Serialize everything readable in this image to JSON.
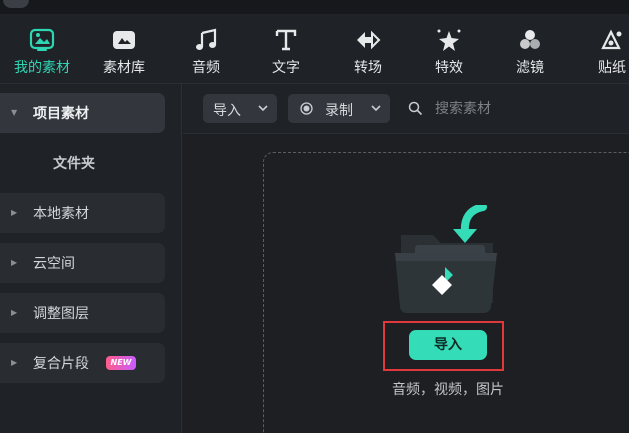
{
  "toolbar": {
    "items": [
      {
        "label": "我的素材",
        "icon": "my-media-icon",
        "active": true
      },
      {
        "label": "素材库",
        "icon": "stock-library-icon",
        "active": false
      },
      {
        "label": "音频",
        "icon": "music-note-icon",
        "active": false
      },
      {
        "label": "文字",
        "icon": "text-icon",
        "active": false
      },
      {
        "label": "转场",
        "icon": "transition-icon",
        "active": false
      },
      {
        "label": "特效",
        "icon": "effects-sparkle-icon",
        "active": false
      },
      {
        "label": "滤镜",
        "icon": "filter-circles-icon",
        "active": false
      },
      {
        "label": "贴纸",
        "icon": "sticker-icon",
        "active": false
      }
    ],
    "accent_color": "#2fd6b4"
  },
  "sidebar": {
    "items": [
      {
        "label": "项目素材",
        "expanded": true
      },
      {
        "label": "文件夹"
      },
      {
        "label": "本地素材"
      },
      {
        "label": "云空间"
      },
      {
        "label": "调整图层"
      },
      {
        "label": "复合片段",
        "badge": "NEW"
      }
    ]
  },
  "header": {
    "import_label": "导入",
    "record_label": "录制",
    "search_placeholder": "搜索素材"
  },
  "dropzone": {
    "import_button": "导入",
    "hint": "音频，视频，图片",
    "button_color": "#35dcb8",
    "highlight_color": "#e0383b"
  }
}
